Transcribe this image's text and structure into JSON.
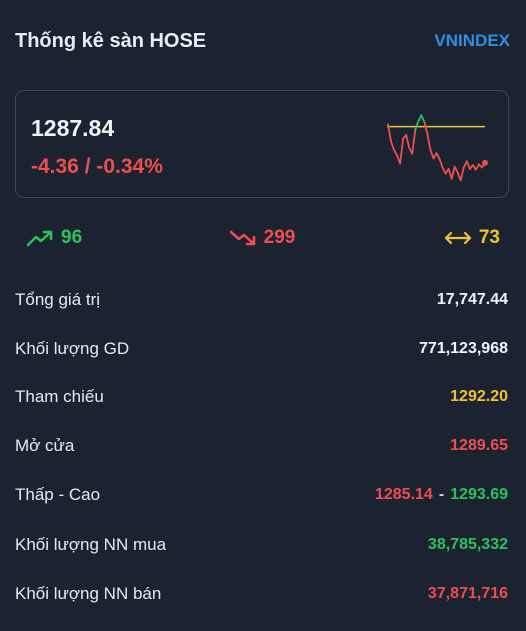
{
  "header": {
    "title": "Thống kê sàn HOSE",
    "index_link": "VNINDEX"
  },
  "summary": {
    "price": "1287.84",
    "change": "-4.36 / -0.34%"
  },
  "sparkline": {
    "reference": 1292.2,
    "points": [
      1292.5,
      1290.2,
      1289.1,
      1288.4,
      1287.3,
      1290.6,
      1291.1,
      1289.4,
      1288.6,
      1291.8,
      1292.9,
      1293.7,
      1292.8,
      1291.2,
      1289.1,
      1288.0,
      1288.7,
      1287.9,
      1286.8,
      1286.0,
      1286.6,
      1285.3,
      1286.9,
      1286.1,
      1285.1,
      1286.8,
      1287.6,
      1286.6,
      1287.1,
      1286.5,
      1287.2,
      1286.8,
      1287.4
    ],
    "min": 1285.0,
    "max": 1294.0,
    "colors": {
      "line": "#ef4e4e",
      "above": "#2bc25a",
      "reference": "#f1c232"
    }
  },
  "breadth": {
    "advances": "96",
    "declines": "299",
    "unchanged": "73"
  },
  "stats": [
    {
      "label": "Tổng giá trị",
      "value": "17,747.44",
      "color": "white"
    },
    {
      "label": "Khối lượng GD",
      "value": "771,123,968",
      "color": "white"
    },
    {
      "label": "Tham chiếu",
      "value": "1292.20",
      "color": "yellow"
    },
    {
      "label": "Mở cửa",
      "value": "1289.65",
      "color": "red"
    }
  ],
  "range": {
    "label": "Thấp - Cao",
    "low": "1285.14",
    "separator": "-",
    "high": "1293.69"
  },
  "foreign": [
    {
      "label": "Khối lượng NN mua",
      "value": "38,785,332",
      "color": "green"
    },
    {
      "label": "Khối lượng NN bán",
      "value": "37,871,716",
      "color": "red"
    }
  ],
  "icons": {
    "up": "trend-up-icon",
    "down": "trend-down-icon",
    "same": "arrows-horizontal-icon"
  }
}
